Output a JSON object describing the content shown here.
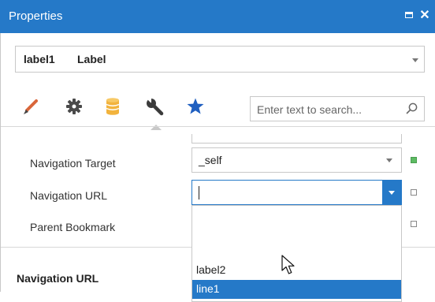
{
  "window": {
    "title": "Properties"
  },
  "selector": {
    "name": "label1",
    "type": "Label"
  },
  "toolbar": {
    "tools": [
      "brush-icon",
      "gear-icon",
      "database-icon",
      "wrench-icon",
      "star-icon"
    ],
    "active_tool": "wrench-icon"
  },
  "search": {
    "placeholder": "Enter text to search..."
  },
  "properties": [
    {
      "label": "Navigation Target",
      "value": "_self"
    },
    {
      "label": "Navigation URL",
      "value": ""
    },
    {
      "label": "Parent Bookmark",
      "value": ""
    }
  ],
  "dropdown": {
    "items": [
      "label2",
      "line1"
    ],
    "selected_index": 1
  },
  "description": {
    "title": "Navigation URL"
  },
  "colors": {
    "accent": "#2579c8",
    "marker_set": "#5dbb63",
    "border": "#c8c8c8"
  }
}
